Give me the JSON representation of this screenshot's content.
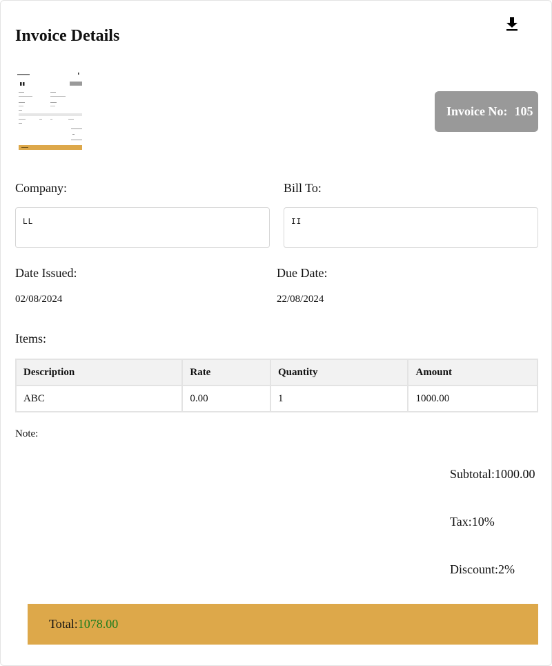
{
  "header": {
    "title": "Invoice Details",
    "download_icon": "download-icon"
  },
  "invoice": {
    "number_label": "Invoice No:",
    "number_value": "105"
  },
  "company": {
    "label": "Company:",
    "value": "LL"
  },
  "bill_to": {
    "label": "Bill To:",
    "value": "II"
  },
  "dates": {
    "issued_label": "Date Issued:",
    "issued_value": "02/08/2024",
    "due_label": "Due Date:",
    "due_value": "22/08/2024"
  },
  "items": {
    "label": "Items:",
    "columns": [
      "Description",
      "Rate",
      "Quantity",
      "Amount"
    ],
    "rows": [
      [
        "ABC",
        "0.00",
        "1",
        "1000.00"
      ]
    ]
  },
  "note": {
    "label": "Note:"
  },
  "summary": {
    "subtotal_label": "Subtotal:",
    "subtotal_value": "1000.00",
    "tax_label": "Tax:",
    "tax_value": "10%",
    "discount_label": "Discount:",
    "discount_value": "2%"
  },
  "total": {
    "label": "Total:",
    "value": "1078.00"
  },
  "colors": {
    "invoice_badge": "#999999",
    "total_bar": "#dda84a",
    "total_value": "#1e7d1e",
    "table_header": "#f2f2f2"
  }
}
